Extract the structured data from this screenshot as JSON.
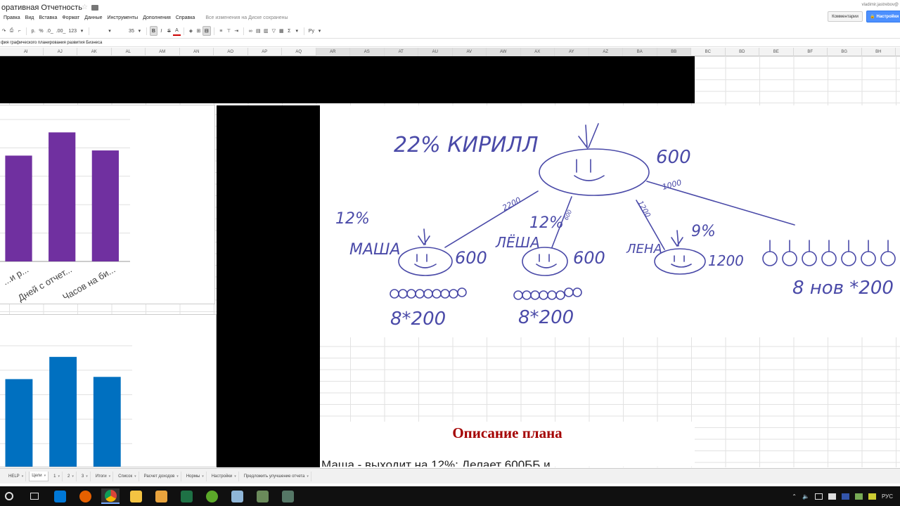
{
  "window": {
    "doc_title": "оративная Отчетность",
    "user_email": "vladimir.jastrebov@",
    "comments_label": "Комментарии",
    "share_label": "Настройки"
  },
  "menu": {
    "items": [
      "Правка",
      "Вид",
      "Вставка",
      "Формат",
      "Данные",
      "Инструменты",
      "Дополнения",
      "Справка"
    ],
    "status": "Все изменения на Диске сохранены"
  },
  "toolbar": {
    "currency": "р.",
    "percent": "%",
    "dec_less": ".0_",
    "dec_more": ".00_",
    "number_format": "123",
    "font_size": "35",
    "bold": "B",
    "italic": "I",
    "strike": "S",
    "text_color": "A",
    "function": "Σ",
    "input_tools": "Ру"
  },
  "formula_bar": {
    "text": "фия графического планирования развития Бизнеса"
  },
  "columns": [
    "AI",
    "AJ",
    "AK",
    "AL",
    "AM",
    "AN",
    "AO",
    "AP",
    "AQ",
    "AR",
    "AS",
    "AT",
    "AU",
    "AV",
    "AW",
    "AX",
    "AY",
    "AZ",
    "BA",
    "BB",
    "BC",
    "BD",
    "BE",
    "BF",
    "BG",
    "BH"
  ],
  "selected_columns_range": [
    "AR",
    "BB"
  ],
  "chart_data": [
    {
      "type": "bar",
      "categories": [
        "...и р...",
        "Дней с отчет...",
        "Часов на би..."
      ],
      "values": [
        82,
        100,
        86
      ],
      "ylim": [
        0,
        110
      ],
      "color": "#7030a0",
      "xlabel": "",
      "ylabel": ""
    },
    {
      "type": "bar",
      "categories": [
        "",
        "",
        ""
      ],
      "values": [
        80,
        100,
        82
      ],
      "ylim": [
        0,
        110
      ],
      "color": "#0070c0",
      "xlabel": "",
      "ylabel": ""
    }
  ],
  "sketch": {
    "top_left_label": "22% КИРИЛЛ",
    "top_right_value": "600",
    "edge_1000": "1000",
    "edge_2200": "2200",
    "edge_1200": "1200",
    "edge_600": "600",
    "masha_pct": "12%",
    "masha_name": "МАША",
    "masha_value": "600",
    "masha_calc": "8*200",
    "lesha_pct": "12%",
    "lesha_name": "ЛЁША",
    "lesha_value": "600",
    "lesha_calc": "8*200",
    "lena_pct": "9%",
    "lena_name": "ЛЕНА",
    "lena_value": "1200",
    "new_calc": "8 нов *200",
    "ink_color": "#4a4aa8"
  },
  "plan": {
    "title": "Описание плана",
    "text": "Маша - выходит на 12%; Делает 600ББ и"
  },
  "sheets": [
    {
      "label": "HELP",
      "active": false
    },
    {
      "label": "Цели",
      "active": true
    },
    {
      "label": "1",
      "active": false
    },
    {
      "label": "2",
      "active": false
    },
    {
      "label": "3",
      "active": false
    },
    {
      "label": "Итоги",
      "active": false
    },
    {
      "label": "Список",
      "active": false
    },
    {
      "label": "Расчет доходов",
      "active": false
    },
    {
      "label": "Нормы",
      "active": false
    },
    {
      "label": "Настройки",
      "active": false
    },
    {
      "label": "Предложить улучшение отчета",
      "active": false
    }
  ],
  "taskbar": {
    "apps": [
      "start",
      "task-view",
      "cortana",
      "firefox",
      "chrome",
      "file-explorer",
      "media-player",
      "excel",
      "utorrent",
      "paint",
      "app-1",
      "app-2"
    ],
    "language": "РУС"
  }
}
